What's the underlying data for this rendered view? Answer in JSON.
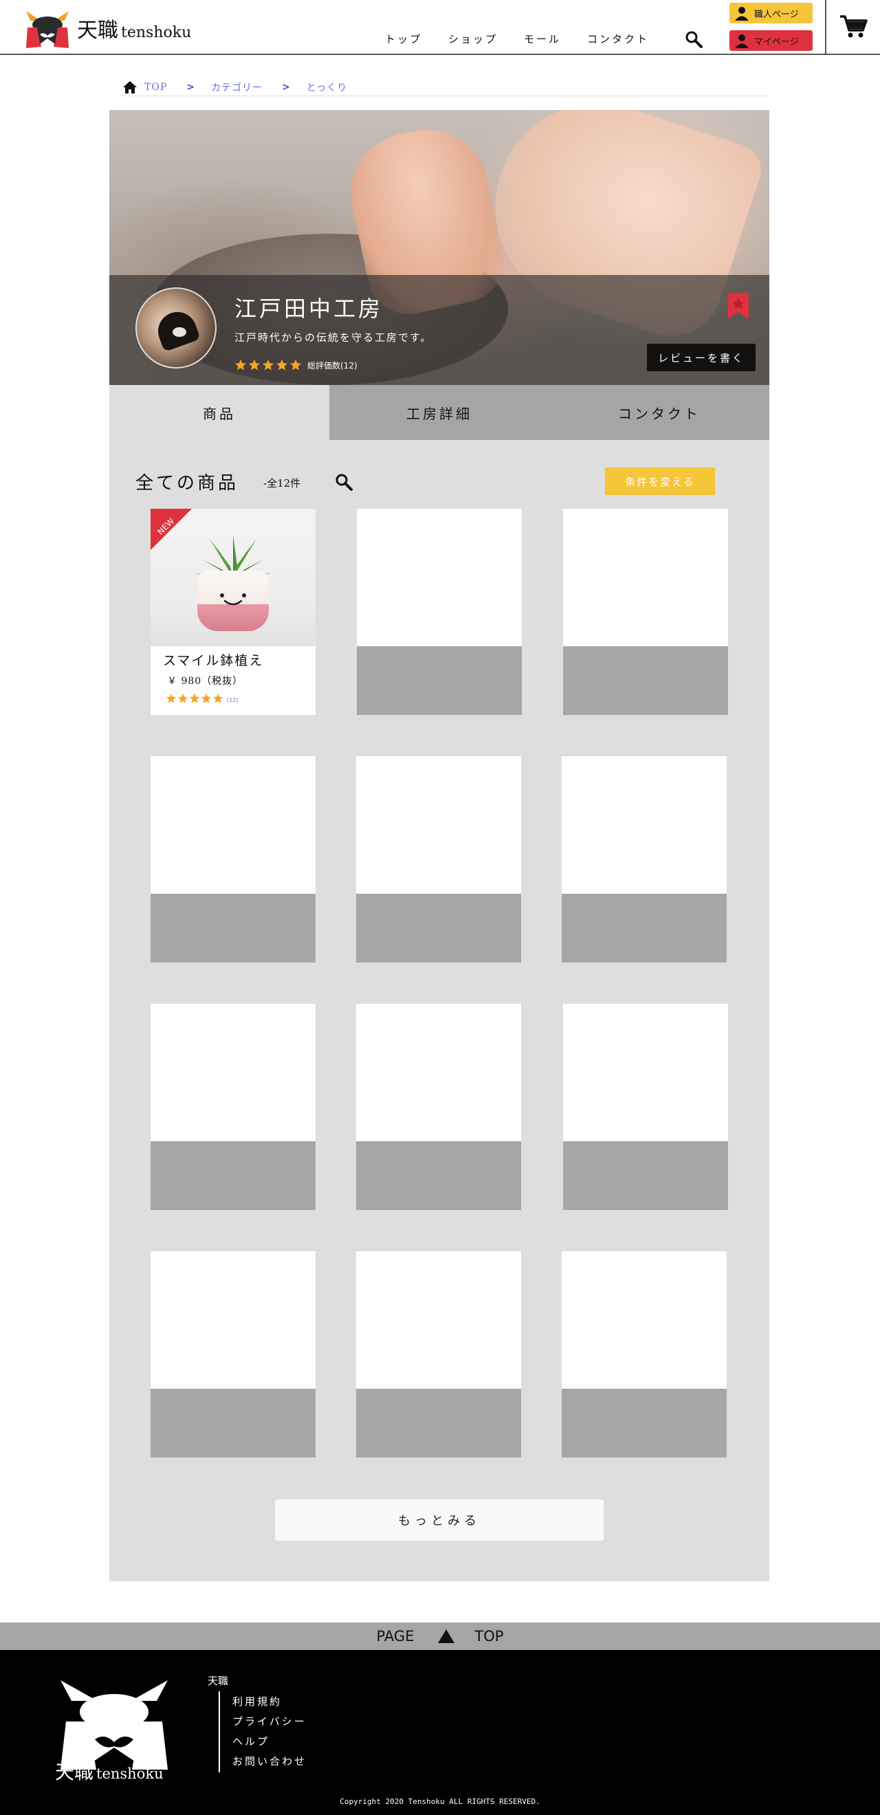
{
  "header": {
    "logo_kanji": "天職",
    "logo_roman": "tenshoku",
    "nav": [
      "トップ",
      "ショップ",
      "モール",
      "コンタクト"
    ],
    "artisan_page_label": "職人ページ",
    "my_page_label": "マイページ",
    "colors": {
      "artisan": "#f5c53a",
      "mypage": "#e0323e"
    }
  },
  "breadcrumb": {
    "items": [
      "TOP",
      "カテゴリー",
      "とっくり"
    ],
    "separator": ">"
  },
  "shop": {
    "name": "江戸田中工房",
    "description": "江戸時代からの伝統を守る工房です。",
    "rating": 5,
    "review_count_label": "総評価数(12)",
    "review_button": "レビューを書く"
  },
  "tabs": [
    {
      "label": "商品",
      "active": true
    },
    {
      "label": "工房詳細",
      "active": false
    },
    {
      "label": "コンタクト",
      "active": false
    }
  ],
  "products_section": {
    "title": "全ての商品",
    "count_label": "-全12件",
    "filter_button": "条件を変える",
    "more_button": "もっとみる"
  },
  "products": [
    {
      "name": "スマイル鉢植え",
      "price": "￥ 980（税抜）",
      "rating": 5,
      "review_count": "(12)",
      "badge": "NEW"
    }
  ],
  "placeholder_card_count": 11,
  "pagetop": {
    "left": "PAGE",
    "right": "TOP"
  },
  "footer": {
    "logo_kanji": "天職",
    "logo_roman": "tenshoku",
    "brand": "天職",
    "links": [
      "利用規約",
      "プライバシー",
      "ヘルプ",
      "お問い合わせ"
    ],
    "copyright": "Copyright 2020 Tenshoku ALL RIGHTS RESERVED."
  },
  "icons": {
    "search": "search-icon",
    "cart": "cart-icon",
    "home": "home-icon",
    "user": "user-icon",
    "star": "star-icon",
    "bookmark": "bookmark-icon",
    "arrow_up": "arrow-up-icon"
  },
  "accent_colors": {
    "star": "#f5a623",
    "link": "#6a6ae6",
    "new_ribbon": "#e0323e"
  }
}
